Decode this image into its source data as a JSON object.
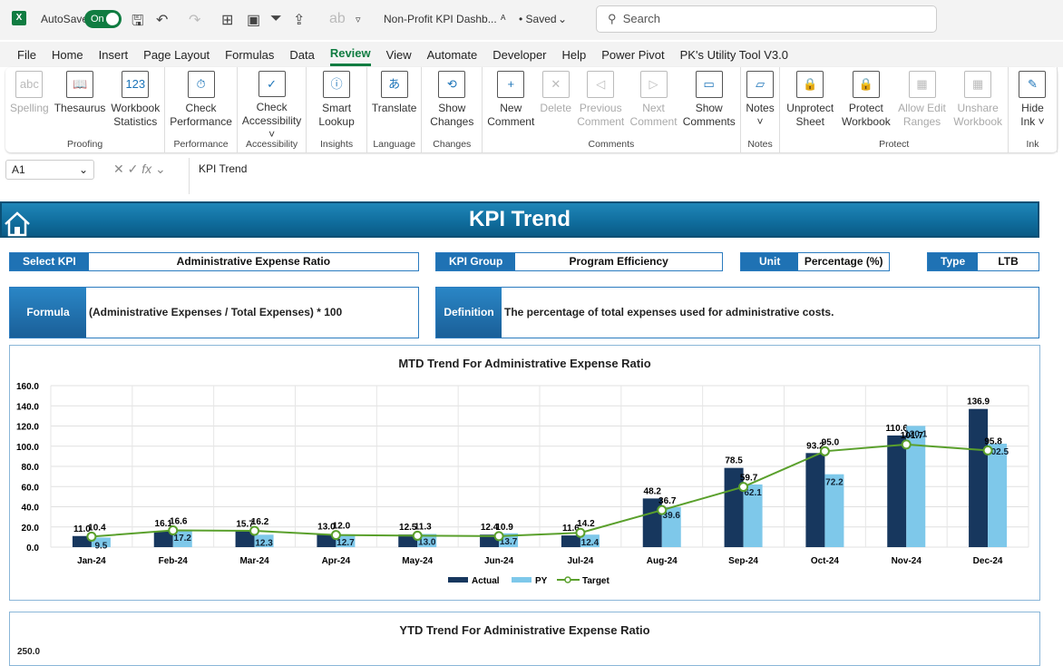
{
  "titlebar": {
    "autosave": "AutoSave",
    "toggle": "On",
    "doc_title": "Non-Profit KPI Dashb...",
    "saved": "• Saved",
    "search_placeholder": "Search"
  },
  "menu": [
    "File",
    "Home",
    "Insert",
    "Page Layout",
    "Formulas",
    "Data",
    "Review",
    "View",
    "Automate",
    "Developer",
    "Help",
    "Power Pivot",
    "PK's Utility Tool V3.0"
  ],
  "active_menu": "Review",
  "ribbon": [
    {
      "label": "Proofing",
      "buttons": [
        {
          "label": "Spelling",
          "icon": "abc",
          "disabled": true
        },
        {
          "label": "Thesaurus",
          "icon": "📖"
        },
        {
          "label": "Workbook Statistics",
          "icon": "123"
        }
      ]
    },
    {
      "label": "Performance",
      "buttons": [
        {
          "label": "Check Performance",
          "icon": "⏱"
        }
      ]
    },
    {
      "label": "Accessibility",
      "buttons": [
        {
          "label": "Check Accessibility ˅",
          "icon": "✓"
        }
      ]
    },
    {
      "label": "Insights",
      "buttons": [
        {
          "label": "Smart Lookup",
          "icon": "ⓘ"
        }
      ]
    },
    {
      "label": "Language",
      "buttons": [
        {
          "label": "Translate",
          "icon": "あ"
        }
      ]
    },
    {
      "label": "Changes",
      "buttons": [
        {
          "label": "Show Changes",
          "icon": "⟲"
        }
      ]
    },
    {
      "label": "Comments",
      "buttons": [
        {
          "label": "New Comment",
          "icon": "+"
        },
        {
          "label": "Delete",
          "icon": "✕",
          "disabled": true
        },
        {
          "label": "Previous Comment",
          "icon": "◁",
          "disabled": true
        },
        {
          "label": "Next Comment",
          "icon": "▷",
          "disabled": true
        },
        {
          "label": "Show Comments",
          "icon": "▭"
        }
      ]
    },
    {
      "label": "Notes",
      "buttons": [
        {
          "label": "Notes ˅",
          "icon": "▱"
        }
      ]
    },
    {
      "label": "Protect",
      "buttons": [
        {
          "label": "Unprotect Sheet",
          "icon": "🔒"
        },
        {
          "label": "Protect Workbook",
          "icon": "🔒"
        },
        {
          "label": "Allow Edit Ranges",
          "icon": "▦",
          "disabled": true
        },
        {
          "label": "Unshare Workbook",
          "icon": "▦",
          "disabled": true
        }
      ]
    },
    {
      "label": "Ink",
      "buttons": [
        {
          "label": "Hide Ink ˅",
          "icon": "✎"
        }
      ]
    }
  ],
  "formula_bar": {
    "cell": "A1",
    "fx": "fx",
    "value": "KPI Trend"
  },
  "sheet": {
    "banner": "KPI Trend",
    "select_kpi_label": "Select KPI",
    "select_kpi": "Administrative Expense Ratio",
    "kpi_group_label": "KPI Group",
    "kpi_group": "Program Efficiency",
    "unit_label": "Unit",
    "unit": "Percentage (%)",
    "type_label": "Type",
    "type": "LTB",
    "formula_label": "Formula",
    "formula": "(Administrative Expenses / Total Expenses) * 100",
    "definition_label": "Definition",
    "definition": "The percentage of total expenses used for administrative costs."
  },
  "colors": {
    "actual": "#17375e",
    "py": "#7ec8ea",
    "target": "#5aa02c",
    "banner": "#1478ab"
  },
  "chart_data": [
    {
      "type": "bar",
      "title": "MTD Trend For Administrative Expense Ratio",
      "categories": [
        "Jan-24",
        "Feb-24",
        "Mar-24",
        "Apr-24",
        "May-24",
        "Jun-24",
        "Jul-24",
        "Aug-24",
        "Sep-24",
        "Oct-24",
        "Nov-24",
        "Dec-24"
      ],
      "ylim": [
        0,
        160
      ],
      "yticks": [
        "0.0",
        "20.0",
        "40.0",
        "60.0",
        "80.0",
        "100.0",
        "120.0",
        "140.0",
        "160.0"
      ],
      "grid": true,
      "legend": "bottom",
      "series": [
        {
          "name": "Actual",
          "type": "bar",
          "values": [
            11.0,
            16.1,
            15.7,
            13.0,
            12.5,
            12.4,
            11.6,
            48.2,
            78.5,
            93.2,
            110.6,
            136.9
          ]
        },
        {
          "name": "PY",
          "type": "bar",
          "values": [
            9.5,
            17.2,
            12.3,
            12.7,
            13.0,
            13.7,
            12.4,
            39.6,
            62.1,
            72.2,
            120.1,
            102.5
          ]
        },
        {
          "name": "Target",
          "type": "line",
          "values": [
            10.4,
            16.6,
            16.2,
            12.0,
            11.3,
            10.9,
            14.2,
            36.7,
            59.7,
            95.0,
            101.7,
            95.8
          ]
        }
      ]
    },
    {
      "type": "bar",
      "title": "YTD Trend For Administrative Expense Ratio",
      "yticks": [
        "250.0"
      ]
    }
  ]
}
